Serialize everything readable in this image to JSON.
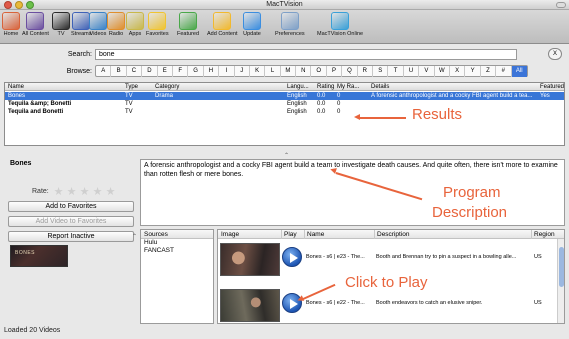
{
  "window": {
    "title": "MacTVision"
  },
  "toolbar": {
    "items": [
      {
        "label": "Home",
        "icon": "home-icon",
        "color": "#d9633a"
      },
      {
        "label": "All Content",
        "icon": "all-content-icon",
        "color": "#6b4fa0"
      },
      {
        "label": "TV",
        "icon": "tv-icon",
        "color": "#2b2b2b"
      },
      {
        "label": "Streams",
        "icon": "streams-icon",
        "color": "#3f62b8"
      },
      {
        "label": "Videos",
        "icon": "videos-icon",
        "color": "#3b83c8"
      },
      {
        "label": "Radio",
        "icon": "radio-icon",
        "color": "#e08f2c"
      },
      {
        "label": "Apps",
        "icon": "apps-icon",
        "color": "#c9b84a"
      },
      {
        "label": "Favorites",
        "icon": "favorites-icon",
        "color": "#f0c431"
      },
      {
        "label": "Featured",
        "icon": "featured-icon",
        "color": "#4aa84a"
      },
      {
        "label": "Add Content",
        "icon": "add-content-icon",
        "color": "#f2b92e"
      },
      {
        "label": "Update",
        "icon": "update-icon",
        "color": "#3b8ee0"
      },
      {
        "label": "Preferences",
        "icon": "preferences-icon",
        "color": "#7ea0c8"
      },
      {
        "label": "MacTVision Online",
        "icon": "globe-icon",
        "color": "#3aa0d8"
      }
    ]
  },
  "search": {
    "label": "Search:",
    "value": "bone",
    "clear_label": "X"
  },
  "browse": {
    "label": "Browse:",
    "letters": [
      "A",
      "B",
      "C",
      "D",
      "E",
      "F",
      "G",
      "H",
      "I",
      "J",
      "K",
      "L",
      "M",
      "N",
      "O",
      "P",
      "Q",
      "R",
      "S",
      "T",
      "U",
      "V",
      "W",
      "X",
      "Y",
      "Z",
      "#",
      "All"
    ],
    "active": "All"
  },
  "results": {
    "headers": {
      "name": "Name",
      "type": "Type",
      "category": "Category",
      "language": "Langu...",
      "rating": "Rating",
      "my_rating": "My Ra...",
      "details": "Details",
      "featured": "Featured"
    },
    "rows": [
      {
        "name": "Bones",
        "type": "TV",
        "category": "Drama",
        "language": "English",
        "rating": "0.0",
        "my_rating": "0",
        "details": "A forensic anthropologist and a cocky FBI agent build a tea...",
        "featured": "Yes"
      },
      {
        "name": "Tequila &amp; Bonetti",
        "type": "TV",
        "category": "",
        "language": "English",
        "rating": "0.0",
        "my_rating": "0",
        "details": "",
        "featured": ""
      },
      {
        "name": "Tequila and Bonetti",
        "type": "TV",
        "category": "",
        "language": "English",
        "rating": "0.0",
        "my_rating": "0",
        "details": "",
        "featured": ""
      }
    ]
  },
  "detail": {
    "title": "Bones",
    "rate_label": "Rate:",
    "star_count": 5,
    "add_favorites": "Add to Favorites",
    "add_video_favorites": "Add Video to Favorites",
    "report_inactive": "Report Inactive",
    "thumb_text": "BONES"
  },
  "description": "A forensic anthropologist and a cocky FBI agent build a team to investigate death causes. And quite often, there isn't more to examine than rotten flesh or mere bones.",
  "sources": {
    "header": "Sources",
    "items": [
      "Hulu",
      "FANCAST"
    ]
  },
  "videos": {
    "headers": {
      "image": "Image",
      "play": "Play",
      "name": "Name",
      "description": "Description",
      "region": "Region"
    },
    "rows": [
      {
        "name": "Bones - s6 | e23 - The...",
        "description": "Booth and Brennan try to pin a suspect in a bowling alle...",
        "region": "US"
      },
      {
        "name": "Bones - s6 | e22 - The...",
        "description": "Booth endeavors to catch an elusive sniper.",
        "region": "US"
      }
    ]
  },
  "annotations": {
    "results": "Results",
    "program": "Program",
    "description": "Description",
    "click_to_play": "Click to Play",
    "color": "#e8643c"
  },
  "status": "Loaded 20 Videos"
}
